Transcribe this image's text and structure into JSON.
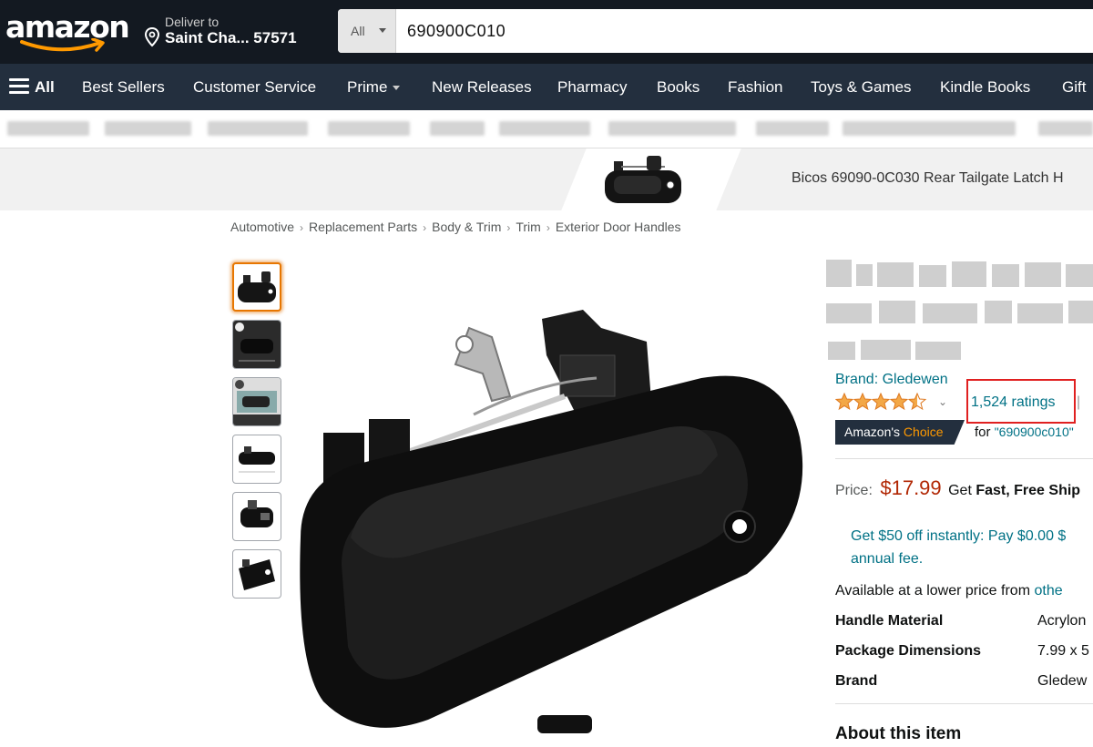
{
  "header": {
    "logo_text": "amazon",
    "deliver_label": "Deliver to",
    "deliver_location": "Saint Cha... 57571",
    "search_category": "All",
    "search_value": "690900C010"
  },
  "nav": {
    "all_label": "All",
    "items": [
      "Best Sellers",
      "Customer Service",
      "Prime",
      "New Releases",
      "Pharmacy",
      "Books",
      "Fashion",
      "Toys & Games",
      "Kindle Books",
      "Gift"
    ]
  },
  "banner": {
    "title": "Bicos 69090-0C030 Rear Tailgate Latch H"
  },
  "breadcrumb": [
    "Automotive",
    "Replacement Parts",
    "Body & Trim",
    "Trim",
    "Exterior Door Handles"
  ],
  "product": {
    "brand": "Brand: Gledewen",
    "rating_stars": 4.5,
    "ratings_count": "1,524 ratings",
    "pipe": "|",
    "choice_prefix": "Amazon's",
    "choice_suffix": "Choice",
    "choice_for_label": "for",
    "choice_for_query": "\"690900c010\"",
    "price_label": "Price:",
    "price": "$17.99",
    "ship_prefix": "Get",
    "ship_bold": "Fast, Free Ship",
    "promo_line1": "Get $50 off instantly: Pay $0.00 $",
    "promo_line2": "annual fee.",
    "lower_price_text": "Available at a lower price from",
    "lower_price_link": "othe",
    "specs": [
      {
        "key": "Handle Material",
        "value": "Acrylon"
      },
      {
        "key": "Package Dimensions",
        "value": "7.99 x 5"
      },
      {
        "key": "Brand",
        "value": "Gledew"
      }
    ],
    "about_heading": "About this item"
  },
  "colors": {
    "header_bg": "#131921",
    "nav_bg": "#232f3e",
    "link": "#007185",
    "price": "#b12704",
    "accent": "#ff9900",
    "highlight_box": "#e02020"
  }
}
